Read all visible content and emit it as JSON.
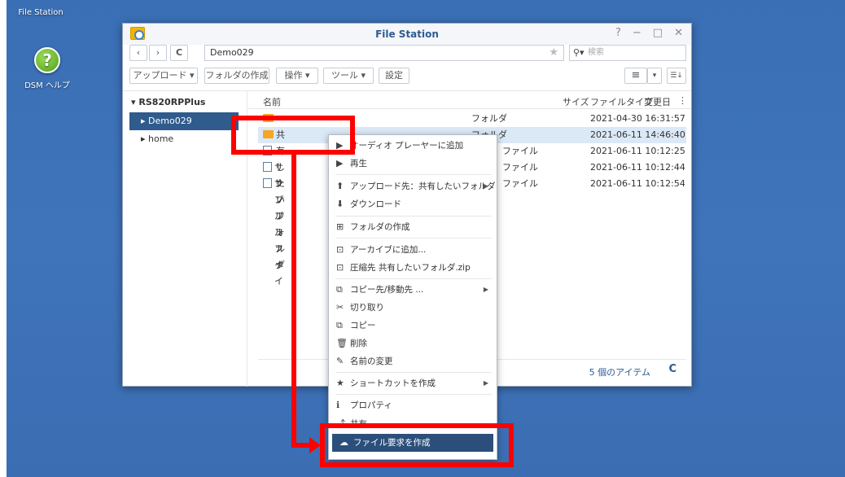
{
  "desktop": {
    "file_station_label": "File Station",
    "help_glyph": "?",
    "help_label": "DSM ヘルプ"
  },
  "window": {
    "title": "File Station",
    "controls": [
      "?",
      "−",
      "□",
      "✕"
    ],
    "nav": {
      "back": "‹",
      "forward": "›",
      "refresh": "C",
      "path": "Demo029",
      "star": "★",
      "search_icon": "⚲▾",
      "search_placeholder": "検索"
    },
    "toolbar": {
      "upload": "アップロード ▾",
      "create_folder": "フォルダの作成",
      "action": "操作 ▾",
      "tools": "ツール ▾",
      "settings": "設定",
      "view_list": "≡",
      "view_dd": "▾",
      "sort": "☰↓"
    },
    "sidebar": {
      "root": "▾ RS820RPPlus",
      "items": [
        {
          "label": "▸ Demo029"
        },
        {
          "label": "▸ home"
        }
      ]
    },
    "list": {
      "columns": {
        "name": "名前",
        "size": "サイズ",
        "type": "ファイルタイプ",
        "modified": "変更日",
        "more": "⋮"
      },
      "rows": [
        {
          "name": "",
          "type": "フォルダ",
          "modified": "2021-04-30 16:31:57"
        },
        {
          "name": "共有したいフォルダ",
          "type": "フォルダ",
          "modified": "2021-06-11 14:46:40"
        },
        {
          "name": "",
          "type": "ファイル",
          "modified": "2021-06-11 10:12:25"
        },
        {
          "name": "サンプルファイ",
          "type": "ファイル",
          "modified": "2021-06-11 10:12:44"
        },
        {
          "name": "サンプルファイ",
          "type": "ファイル",
          "modified": "2021-06-11 10:12:54"
        }
      ]
    },
    "status": {
      "count": "5 個のアイテム",
      "refresh": "C"
    }
  },
  "context_menu": {
    "items": [
      {
        "icon": "▶",
        "label": "オーディオ プレーヤーに追加"
      },
      {
        "icon": "▶",
        "label": "再生"
      },
      {
        "icon": "⬆",
        "label": "アップロード先：共有したいフォルダ",
        "arrow": "▶"
      },
      {
        "icon": "⬇",
        "label": "ダウンロード"
      },
      {
        "icon": "⊞",
        "label": "フォルダの作成"
      },
      {
        "icon": "⊡",
        "label": "アーカイブに追加..."
      },
      {
        "icon": "⊡",
        "label": "圧縮先 共有したいフォルダ.zip"
      },
      {
        "icon": "⧉",
        "label": "コピー先/移動先 ...",
        "arrow": "▶"
      },
      {
        "icon": "✂",
        "label": "切り取り"
      },
      {
        "icon": "⧉",
        "label": "コピー"
      },
      {
        "icon": "🗑",
        "label": "削除"
      },
      {
        "icon": "✎",
        "label": "名前の変更"
      },
      {
        "icon": "★",
        "label": "ショートカットを作成",
        "arrow": "▶"
      },
      {
        "icon": "ℹ",
        "label": "プロパティ"
      },
      {
        "icon": "⤴",
        "label": "共有"
      },
      {
        "icon": "☁",
        "label": "ファイル要求を作成"
      }
    ]
  },
  "colors": {
    "desktop": "#3f74bb",
    "selection": "#2f5b8d",
    "annotation": "#ff0000"
  }
}
